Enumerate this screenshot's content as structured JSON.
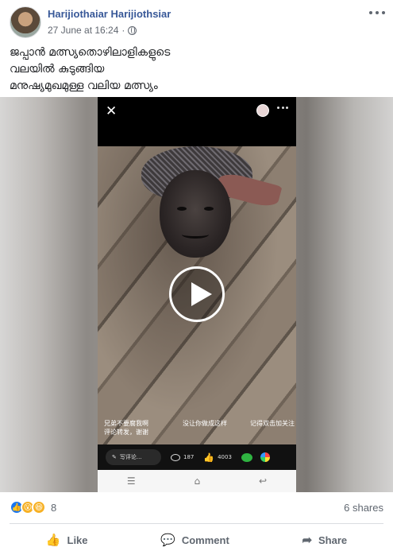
{
  "post": {
    "author": "Harijiothaiar Harijiothsiar",
    "timestamp": "27 June at 16:24",
    "separator": "·",
    "privacy_icon": "globe-icon",
    "text_lines": [
      "ജപ്പാൻ മത്സ്യതൊഴിലാളികളുടെ",
      "വലയിൽ കുടുങ്ങിയ",
      "മനുഷ്യമുഖമുള്ള വലിയ മത്സ്യം"
    ]
  },
  "video": {
    "subtitle_left": "兄弟不要腐我啊\n评论转发，谢谢",
    "subtitle_mid": "没让你做成这样",
    "subtitle_right": "记得双击加关注",
    "comment_placeholder": "写评论...",
    "comment_count": "187",
    "like_count": "4003"
  },
  "footer": {
    "reaction_count": "8",
    "shares": "6 shares",
    "like_label": "Like",
    "comment_label": "Comment",
    "share_label": "Share"
  },
  "colors": {
    "author": "#385898",
    "meta": "#616770",
    "like_blue": "#1877f2"
  }
}
